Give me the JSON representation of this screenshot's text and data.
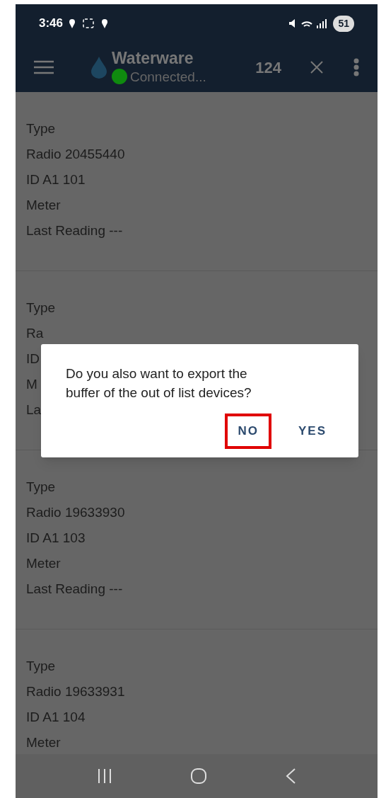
{
  "status_bar": {
    "time": "3:46",
    "battery": "51"
  },
  "app_bar": {
    "title": "Waterware",
    "connection": {
      "label": "Connected...",
      "color": "#0f8a0f"
    },
    "count": "124"
  },
  "devices": [
    {
      "lines": [
        "Type",
        "Radio 20455440",
        "ID A1 101",
        "Meter",
        "Last Reading ---"
      ]
    },
    {
      "lines": [
        "Type",
        "Ra",
        "ID",
        "M",
        "La"
      ]
    },
    {
      "lines": [
        "Type",
        "Radio 19633930",
        "ID A1 103",
        "Meter",
        "Last Reading ---"
      ]
    },
    {
      "lines": [
        "Type",
        "Radio 19633931",
        "ID A1 104",
        "Meter"
      ]
    }
  ],
  "dialog": {
    "message": "Do you also want to export the buffer of the out of list devices?",
    "buttons": [
      {
        "label": "NO",
        "highlighted": true
      },
      {
        "label": "YES",
        "highlighted": false
      }
    ]
  }
}
